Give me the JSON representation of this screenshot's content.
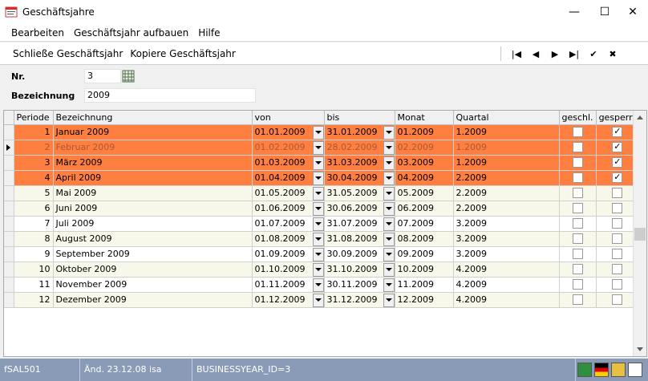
{
  "window": {
    "title": "Geschäftsjahre",
    "minimize": "—",
    "maximize": "☐",
    "close": "✕"
  },
  "menu": [
    {
      "label": "Bearbeiten"
    },
    {
      "label": "Geschäftsjahr aufbauen"
    },
    {
      "label": "Hilfe"
    }
  ],
  "toolbar": {
    "close_year": "Schließe Geschäftsjahr",
    "copy_year": "Kopiere Geschäftsjahr",
    "nav": [
      "|◀",
      "◀",
      "▶",
      "▶|",
      "✔",
      "✖"
    ]
  },
  "form": {
    "nr_label": "Nr.",
    "nr_value": "3",
    "bez_label": "Bezeichnung",
    "bez_value": "2009"
  },
  "grid": {
    "columns": [
      "Periode",
      "Bezeichnung",
      "von",
      "bis",
      "Monat",
      "Quartal",
      "geschl.",
      "gesperrt"
    ],
    "rows": [
      {
        "periode": "1",
        "bez": "Januar 2009",
        "von": "01.01.2009",
        "bis": "31.01.2009",
        "monat": "01.2009",
        "quartal": "1.2009",
        "geschl": false,
        "gesperrt": true,
        "style": "orange"
      },
      {
        "periode": "2",
        "bez": "Februar 2009",
        "von": "01.02.2009",
        "bis": "28.02.2009",
        "monat": "02.2009",
        "quartal": "1.2009",
        "geschl": false,
        "gesperrt": true,
        "style": "orange cur"
      },
      {
        "periode": "3",
        "bez": "März 2009",
        "von": "01.03.2009",
        "bis": "31.03.2009",
        "monat": "03.2009",
        "quartal": "1.2009",
        "geschl": false,
        "gesperrt": true,
        "style": "orange"
      },
      {
        "periode": "4",
        "bez": "April 2009",
        "von": "01.04.2009",
        "bis": "30.04.2009",
        "monat": "04.2009",
        "quartal": "2.2009",
        "geschl": false,
        "gesperrt": true,
        "style": "orange"
      },
      {
        "periode": "5",
        "bez": "Mai 2009",
        "von": "01.05.2009",
        "bis": "31.05.2009",
        "monat": "05.2009",
        "quartal": "2.2009",
        "geschl": false,
        "gesperrt": false,
        "style": "ev"
      },
      {
        "periode": "6",
        "bez": "Juni 2009",
        "von": "01.06.2009",
        "bis": "30.06.2009",
        "monat": "06.2009",
        "quartal": "2.2009",
        "geschl": false,
        "gesperrt": false,
        "style": "ev"
      },
      {
        "periode": "7",
        "bez": "Juli 2009",
        "von": "01.07.2009",
        "bis": "31.07.2009",
        "monat": "07.2009",
        "quartal": "3.2009",
        "geschl": false,
        "gesperrt": false,
        "style": "od"
      },
      {
        "periode": "8",
        "bez": "August 2009",
        "von": "01.08.2009",
        "bis": "31.08.2009",
        "monat": "08.2009",
        "quartal": "3.2009",
        "geschl": false,
        "gesperrt": false,
        "style": "ev"
      },
      {
        "periode": "9",
        "bez": "September 2009",
        "von": "01.09.2009",
        "bis": "30.09.2009",
        "monat": "09.2009",
        "quartal": "3.2009",
        "geschl": false,
        "gesperrt": false,
        "style": "od"
      },
      {
        "periode": "10",
        "bez": "Oktober 2009",
        "von": "01.10.2009",
        "bis": "31.10.2009",
        "monat": "10.2009",
        "quartal": "4.2009",
        "geschl": false,
        "gesperrt": false,
        "style": "ev"
      },
      {
        "periode": "11",
        "bez": "November 2009",
        "von": "01.11.2009",
        "bis": "30.11.2009",
        "monat": "11.2009",
        "quartal": "4.2009",
        "geschl": false,
        "gesperrt": false,
        "style": "od"
      },
      {
        "periode": "12",
        "bez": "Dezember 2009",
        "von": "01.12.2009",
        "bis": "31.12.2009",
        "monat": "12.2009",
        "quartal": "4.2009",
        "geschl": false,
        "gesperrt": false,
        "style": "ev"
      }
    ]
  },
  "status": {
    "form_id": "fSAL501",
    "changed": "Änd. 23.12.08 isa",
    "record": "BUSINESSYEAR_ID=3"
  },
  "colors": {
    "highlight_row": "#ff7f40",
    "statusbar": "#8a9bb8"
  }
}
